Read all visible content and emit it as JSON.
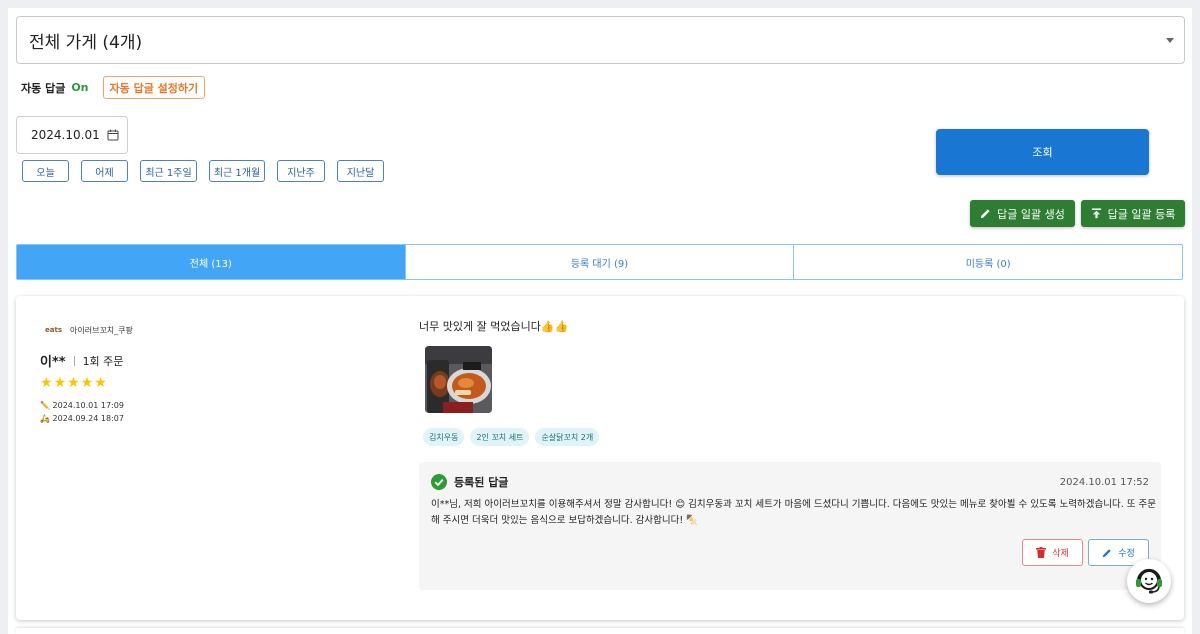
{
  "store_select": {
    "value": "전체 가게 (4개)"
  },
  "auto_reply": {
    "label": "자동 답글",
    "status": "On",
    "settings_button": "자동 답글 설정하기"
  },
  "date_filter": {
    "date": "2024.10.01",
    "quick_buttons": [
      "오늘",
      "어제",
      "최근 1주일",
      "최근 1개월",
      "지난주",
      "지난달"
    ]
  },
  "actions": {
    "search": "조회",
    "bulk_generate": "답글 일괄 생성",
    "bulk_register": "답글 일괄 등록"
  },
  "tabs": [
    {
      "label": "전체 (13)",
      "active": true
    },
    {
      "label": "등록 대기 (9)",
      "active": false
    },
    {
      "label": "미등록 (0)",
      "active": false
    }
  ],
  "review": {
    "brand_logo": "eats",
    "store_name": "아이러브꼬치_쿠팡",
    "customer": "이**",
    "order_count": "1회 주문",
    "rating": 5,
    "written_at": "2024.10.01 17:09",
    "ordered_at": "2024.09.24 18:07",
    "text": "너무 맛있게 잘 먹었습니다👍👍",
    "menu_chips": [
      "김치우동",
      "2인 꼬치 세트",
      "순살닭꼬치 2개"
    ],
    "reply": {
      "title": "등록된 답글",
      "date": "2024.10.01 17:52",
      "body": "이**님, 저희 아이러브꼬치를 이용해주셔서 정말 감사합니다! 😊 김치우동과 꼬치 세트가 마음에 드셨다니 기쁩니다. 다음에도 맛있는 메뉴로 찾아뵐 수 있도록 노력하겠습니다. 또 주문해 주시면 더욱더 맛있는 음식으로 보답하겠습니다. 감사합니다! 🍢",
      "delete_label": "삭제",
      "edit_label": "수정"
    }
  },
  "colors": {
    "primary": "#1976d2",
    "green": "#2e7d32",
    "active_tab": "#42a5f5",
    "star": "#f7c600"
  }
}
